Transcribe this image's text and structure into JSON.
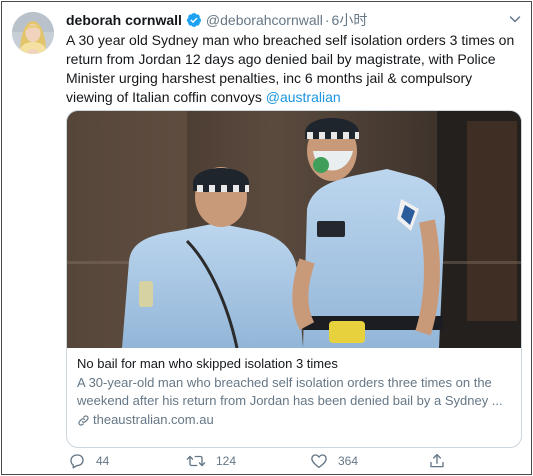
{
  "tweet": {
    "author_name": "deborah cornwall",
    "handle": "@deborahcornwall",
    "separator": "·",
    "time": "6小时",
    "text_main": "A 30 year old Sydney man who breached self isolation orders 3 times on return from Jordan 12 days ago denied bail by magistrate, with Police Minister urging harshest penalties, inc 6 months jail & compulsory viewing of Italian coffin convoys ",
    "mention": "@australian"
  },
  "card": {
    "title": "No bail for man who skipped isolation 3 times",
    "description": "A 30-year-old man who breached self isolation orders three times on the weekend after his return from Jordan has been denied bail by a Sydney ...",
    "domain": "theaustralian.com.au"
  },
  "actions": {
    "reply_count": "44",
    "retweet_count": "124",
    "like_count": "364"
  },
  "colors": {
    "accent": "#1da1f2",
    "link": "#1b95e0",
    "secondary_text": "#657786"
  },
  "icons": [
    "verified-badge-icon",
    "caret-down-icon",
    "link-icon",
    "reply-icon",
    "retweet-icon",
    "like-icon",
    "share-icon"
  ]
}
